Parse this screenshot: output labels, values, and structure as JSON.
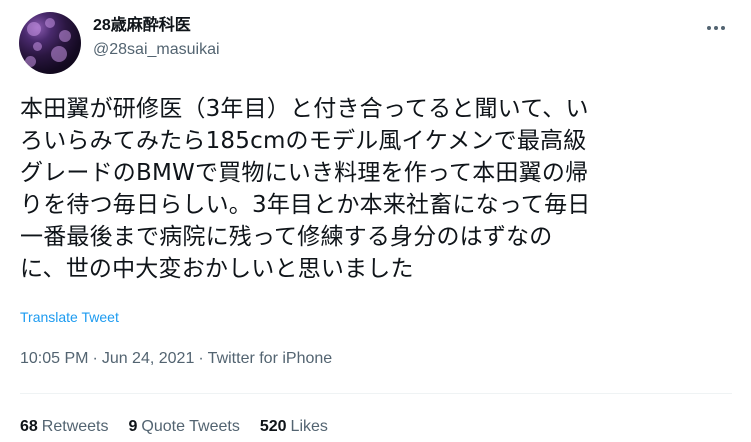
{
  "author": {
    "display_name": "28歳麻酔科医",
    "handle": "@28sai_masuikai"
  },
  "tweet": {
    "lines": [
      "本田翼が研修医（3年目）と付き合ってると聞いて、い",
      "ろいらみてみたら185cmのモデル風イケメンで最高級",
      "グレードのBMWで買物にいき料理を作って本田翼の帰",
      "りを待つ毎日らしい。3年目とか本来社畜になって毎日",
      "一番最後まで病院に残って修練する身分のはずなの",
      "に、世の中大変おかしいと思いました"
    ],
    "translate_label": "Translate Tweet"
  },
  "meta": {
    "time": "10:05 PM",
    "date": "Jun 24, 2021",
    "source": "Twitter for iPhone",
    "separator": "·"
  },
  "stats": {
    "retweets": {
      "count": "68",
      "label": "Retweets"
    },
    "quote_tweets": {
      "count": "9",
      "label": "Quote Tweets"
    },
    "likes": {
      "count": "520",
      "label": "Likes"
    }
  },
  "icons": {
    "more": "more-horizontal-icon"
  }
}
